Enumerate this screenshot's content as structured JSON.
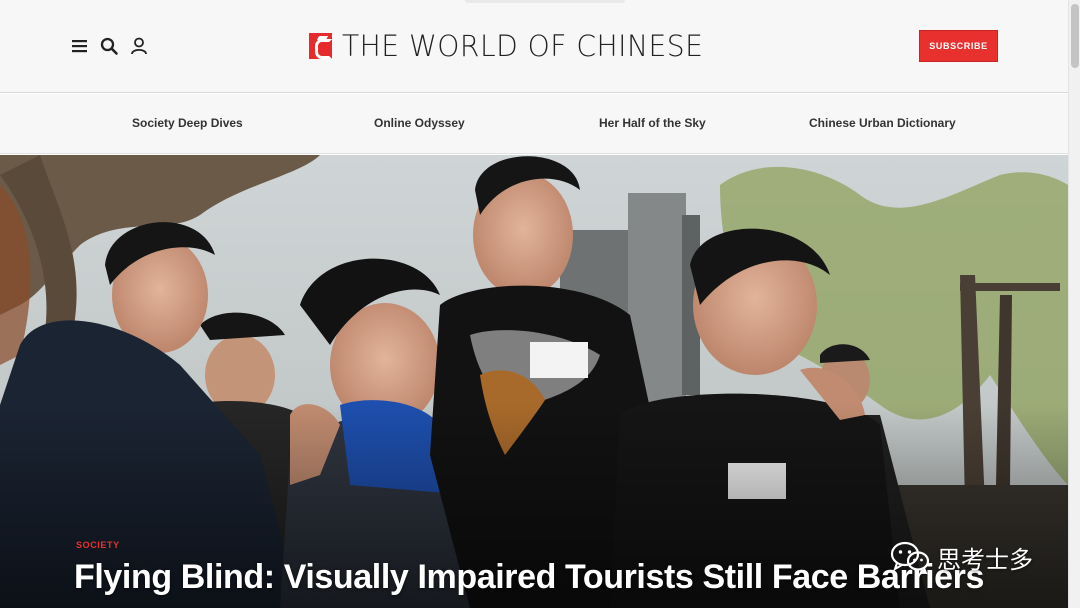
{
  "header": {
    "logo_text": "THE WORLD OF CHINESE",
    "subscribe_label": "SUBSCRIBE",
    "icons": [
      "menu-icon",
      "search-icon",
      "user-icon"
    ],
    "brand_color": "#e8312f"
  },
  "nav": {
    "items": [
      {
        "label": "Society Deep Dives"
      },
      {
        "label": "Online Odyssey"
      },
      {
        "label": "Her Half of the Sky"
      },
      {
        "label": "Chinese Urban Dictionary"
      }
    ]
  },
  "featured": {
    "category": "SOCIETY",
    "title": "Flying Blind: Visually Impaired Tourists Still Face Barriers"
  },
  "watermark": {
    "text": "思考士多",
    "icon": "wechat-icon"
  }
}
